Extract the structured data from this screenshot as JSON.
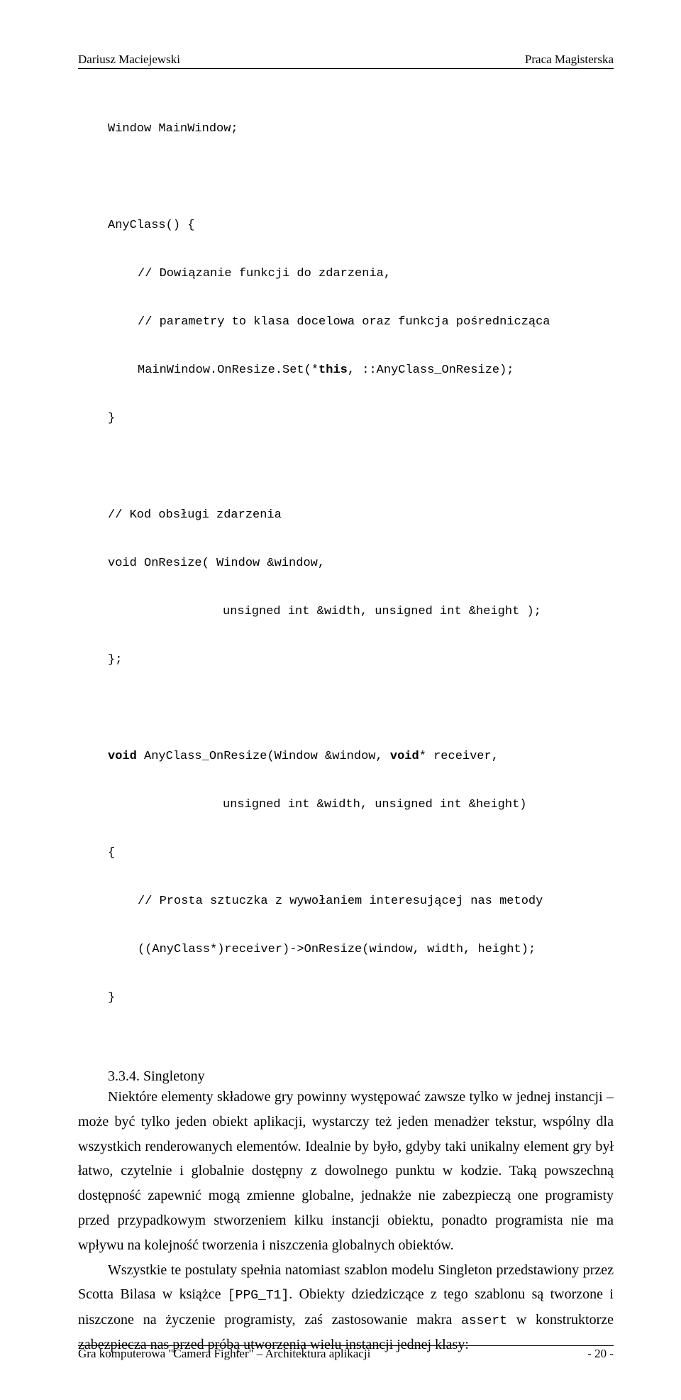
{
  "header": {
    "left": "Dariusz Maciejewski",
    "right": "Praca Magisterska"
  },
  "code": {
    "l1": "Window MainWindow;",
    "l2": "AnyClass() {",
    "l3": "// Dowiązanie funkcji do zdarzenia,",
    "l4": "// parametry to klasa docelowa oraz funkcja pośrednicząca",
    "l5a": "MainWindow.OnResize.Set(*",
    "l5b": "this",
    "l5c": ", ::AnyClass_OnResize);",
    "l6": "}",
    "l7": "// Kod obsługi zdarzenia",
    "l8": "void OnResize( Window &window,",
    "l9": "unsigned int &width, unsigned int &height );",
    "l10": "};",
    "l11a": "void",
    "l11b": " AnyClass_OnResize(Window &window, ",
    "l11c": "void",
    "l11d": "* receiver,",
    "l12": "unsigned int &width, unsigned int &height)",
    "l13": "{",
    "l14": "// Prosta sztuczka z wywołaniem interesującej nas metody",
    "l15": "((AnyClass*)receiver)->OnResize(window, width, height);",
    "l16": "}"
  },
  "section": {
    "number": "3.3.4.",
    "title": "Singletony"
  },
  "para1": {
    "t1": "Niektóre elementy składowe gry powinny występować zawsze tylko w jednej instancji – może być tylko jeden obiekt aplikacji, wystarczy też jeden menadżer tekstur, wspólny dla wszystkich renderowanych elementów. Idealnie by było, gdyby taki unikalny element gry był łatwo, czytelnie i globalnie dostępny z dowolnego punktu w kodzie. Taką powszechną dostępność zapewnić mogą zmienne globalne, jednakże nie zabezpieczą one programisty przed przypadkowym stworzeniem kilku instancji obiektu, ponadto programista nie ma wpływu na kolejność tworzenia i niszczenia globalnych obiektów."
  },
  "para2": {
    "t1": "Wszystkie te postulaty spełnia natomiast szablon modelu Singleton przedstawiony przez Scotta Bilasa w książce ",
    "code1": "[PPG_T1]",
    "t2": ". Obiekty dziedziczące z tego szablonu są tworzone i niszczone na życzenie programisty, zaś zastosowanie makra ",
    "code2": "assert",
    "t3": " w konstruktorze zabezpiecza nas przed próbą utworzenia wielu instancji jednej klasy:"
  },
  "footer": {
    "left": "Gra komputerowa \"Camera Fighter\" – Architektura aplikacji",
    "right": "- 20 -"
  }
}
